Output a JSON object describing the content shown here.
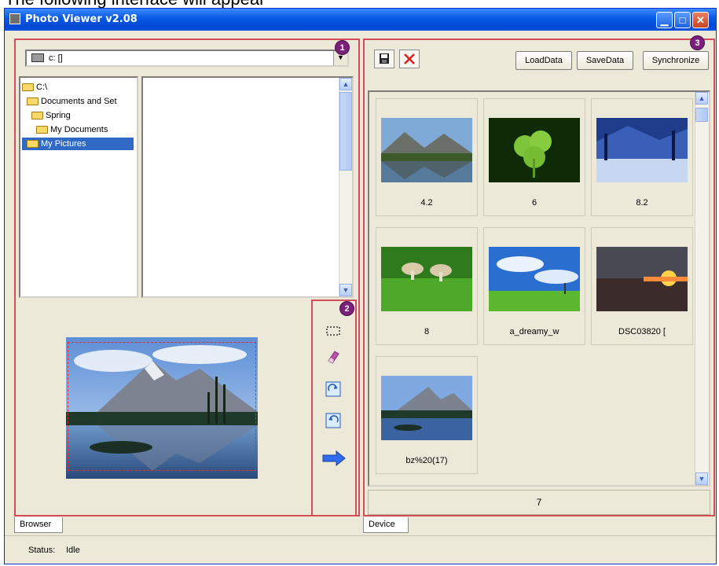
{
  "caption": "The following interface will appear",
  "window": {
    "title": "Photo Viewer v2.08"
  },
  "badges": [
    "1",
    "2",
    "3"
  ],
  "browser": {
    "drive_value": "c: []",
    "tree": [
      "C:\\",
      "Documents and Set",
      "Spring",
      "My Documents",
      "My Pictures"
    ],
    "selected": "My Pictures"
  },
  "tools": [
    "select-rect-icon",
    "eraser-icon",
    "rotate-right-icon",
    "rotate-left-icon",
    "send-arrow-icon"
  ],
  "device": {
    "buttons": {
      "load": "LoadData",
      "save": "SaveData",
      "sync": "Synchronize"
    },
    "thumbnails": [
      "4.2",
      "6",
      "8.2",
      "8",
      "a_dreamy_w",
      "DSC03820 [",
      "bz%20(17)"
    ],
    "count": "7"
  },
  "tabs": {
    "left": "Browser",
    "right": "Device"
  },
  "status": {
    "label": "Status:",
    "value": "Idle"
  },
  "colors": {
    "highlight": "#d24c5a",
    "badge": "#7a1f7a",
    "selection": "#316ac5"
  }
}
